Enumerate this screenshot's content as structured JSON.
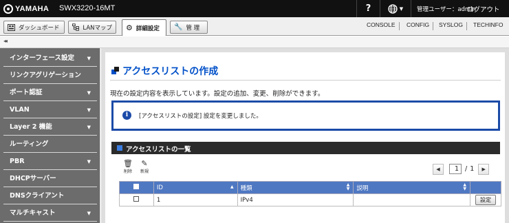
{
  "header": {
    "brand": "YAMAHA",
    "model": "SWX3220-16MT",
    "help_label": "?",
    "lang_arrow": "▼",
    "user_label": "管理ユーザー：admin",
    "logout_label": "ログアウト"
  },
  "tabs": [
    {
      "label": "ダッシュボード",
      "icon": "dashboard-icon"
    },
    {
      "label": "LANマップ",
      "icon": "network-map-icon"
    },
    {
      "label": "詳細設定",
      "icon": "gear-icon",
      "active": true
    },
    {
      "label": "管 理",
      "icon": "wrench-icon"
    }
  ],
  "sysnav": [
    "CONSOLE",
    "CONFIG",
    "SYSLOG",
    "TECHINFO"
  ],
  "sidebar": {
    "collapse_label": "◂◂",
    "items": [
      {
        "label": "インターフェース設定",
        "arrow": "▼"
      },
      {
        "label": "リンクアグリゲーション",
        "arrow": ""
      },
      {
        "label": "ポート認証",
        "arrow": "▼"
      },
      {
        "label": "VLAN",
        "arrow": "▼"
      },
      {
        "label": "Layer 2 機能",
        "arrow": "▼"
      },
      {
        "label": "ルーティング",
        "arrow": ""
      },
      {
        "label": "PBR",
        "arrow": "▼"
      },
      {
        "label": "DHCPサーバー",
        "arrow": ""
      },
      {
        "label": "DNSクライアント",
        "arrow": ""
      },
      {
        "label": "マルチキャスト",
        "arrow": "▼"
      }
    ]
  },
  "main": {
    "title": "アクセスリストの作成",
    "description": "現在の設定内容を表示しています。設定の追加、変更、削除ができます。",
    "notice": "[アクセスリストの設定] 設定を変更しました。",
    "section_title": "アクセスリストの一覧",
    "tools": {
      "delete_label": "削除",
      "new_label": "新規"
    },
    "pager": {
      "prev": "◀",
      "current": "1",
      "slash": "/",
      "total": "1",
      "next": "▶"
    },
    "table": {
      "columns": [
        "",
        "ID",
        "種類",
        "説明",
        ""
      ],
      "rows": [
        {
          "checked": false,
          "id": "1",
          "type": "IPv4",
          "description": "",
          "action_label": "設定"
        }
      ]
    }
  },
  "colors": {
    "accent": "#0050c8",
    "header_bg": "#111111",
    "sidebar_bg": "#6c6c6c",
    "table_header": "#4f78c2"
  }
}
